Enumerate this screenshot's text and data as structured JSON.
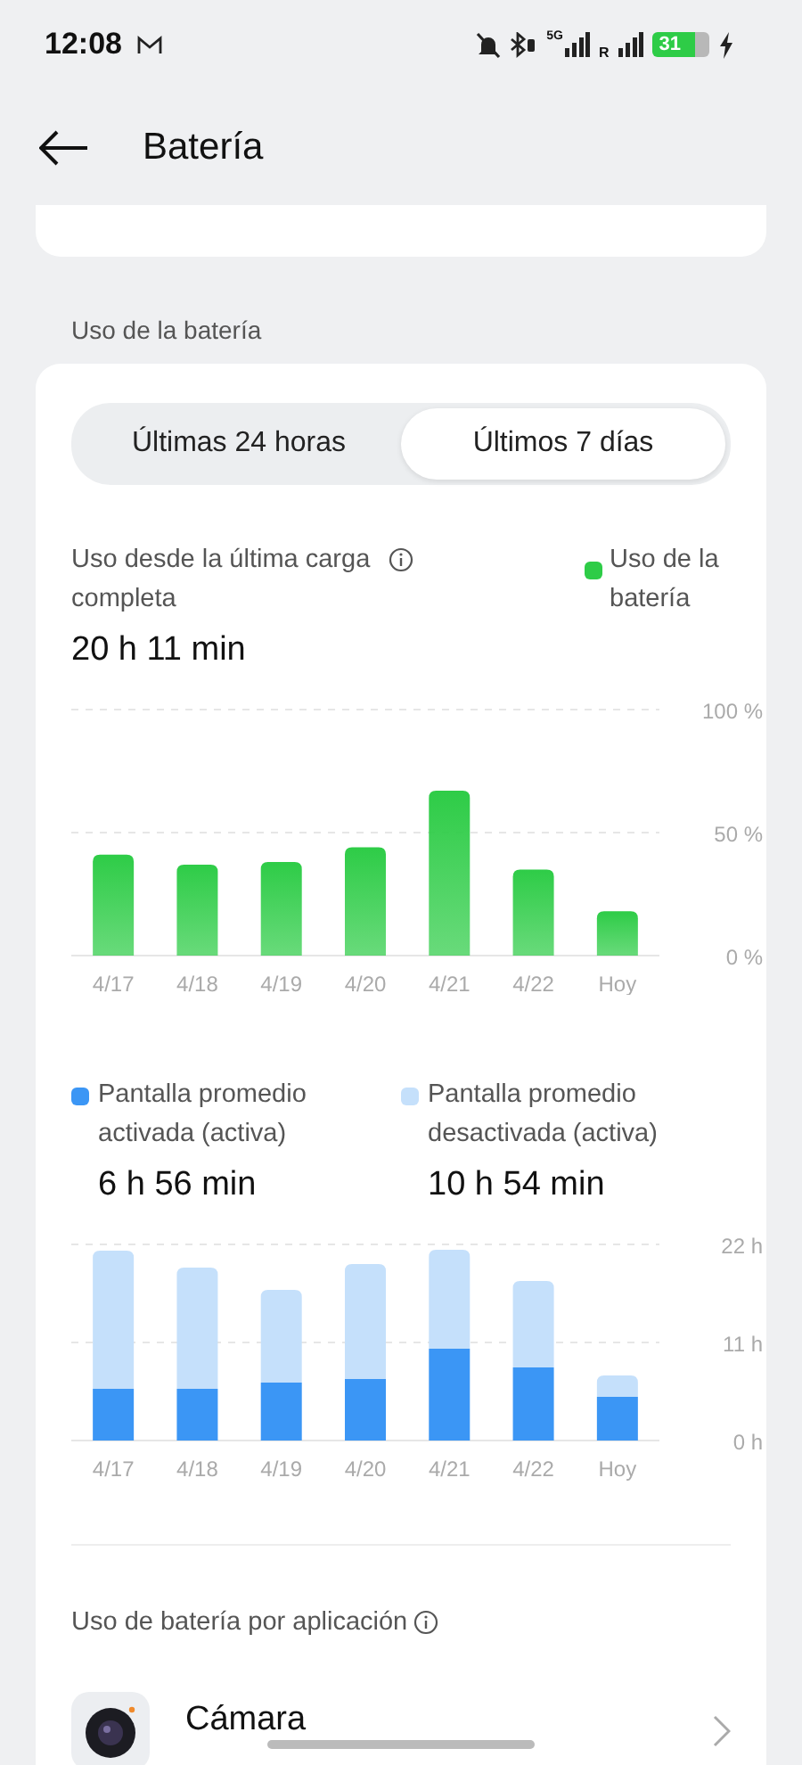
{
  "status_bar": {
    "time": "12:08",
    "network": "5G",
    "roaming": "R",
    "battery": "31"
  },
  "header": {
    "title": "Batería"
  },
  "section_title": "Uso de la batería",
  "tabs": [
    {
      "label": "Últimas 24 horas",
      "selected": false
    },
    {
      "label": "Últimos 7 días",
      "selected": true
    }
  ],
  "usage": {
    "label": "Uso desde la última carga completa",
    "value": "20 h 11 min",
    "chart_data": {
      "type": "bar",
      "categories": [
        "4/17",
        "4/18",
        "4/19",
        "4/20",
        "4/21",
        "4/22",
        "Hoy"
      ],
      "ylim": [
        0,
        100
      ],
      "yticks": [
        {
          "value": 0,
          "label": "0 %"
        },
        {
          "value": 50,
          "label": "50 %"
        },
        {
          "value": 100,
          "label": "100 %"
        }
      ],
      "series": [
        {
          "name": "Uso de la batería",
          "color": "#2ecc47",
          "values": [
            41,
            37,
            38,
            44,
            67,
            35,
            18
          ]
        }
      ]
    }
  },
  "screen": {
    "totals": [
      "6 h 56 min",
      "10 h 54 min"
    ],
    "chart_data": {
      "type": "bar",
      "stacked": true,
      "categories": [
        "4/17",
        "4/18",
        "4/19",
        "4/20",
        "4/21",
        "4/22",
        "Hoy"
      ],
      "ylim": [
        0,
        22
      ],
      "yticks": [
        {
          "value": 0,
          "label": "0 h"
        },
        {
          "value": 11,
          "label": "11 h"
        },
        {
          "value": 22,
          "label": "22 h"
        }
      ],
      "series": [
        {
          "name": "Pantalla promedio activada (activa)",
          "color": "#3b96f5",
          "values": [
            5.8,
            5.8,
            6.5,
            6.9,
            10.3,
            8.2,
            4.9
          ]
        },
        {
          "name": "Pantalla promedio desactivada (activa)",
          "color": "#c5e0fb",
          "values": [
            15.5,
            13.6,
            10.4,
            12.9,
            11.1,
            9.7,
            2.4
          ]
        }
      ]
    }
  },
  "apps": {
    "title": "Uso de batería por aplicación",
    "items": [
      {
        "name": "Cámara"
      }
    ]
  }
}
